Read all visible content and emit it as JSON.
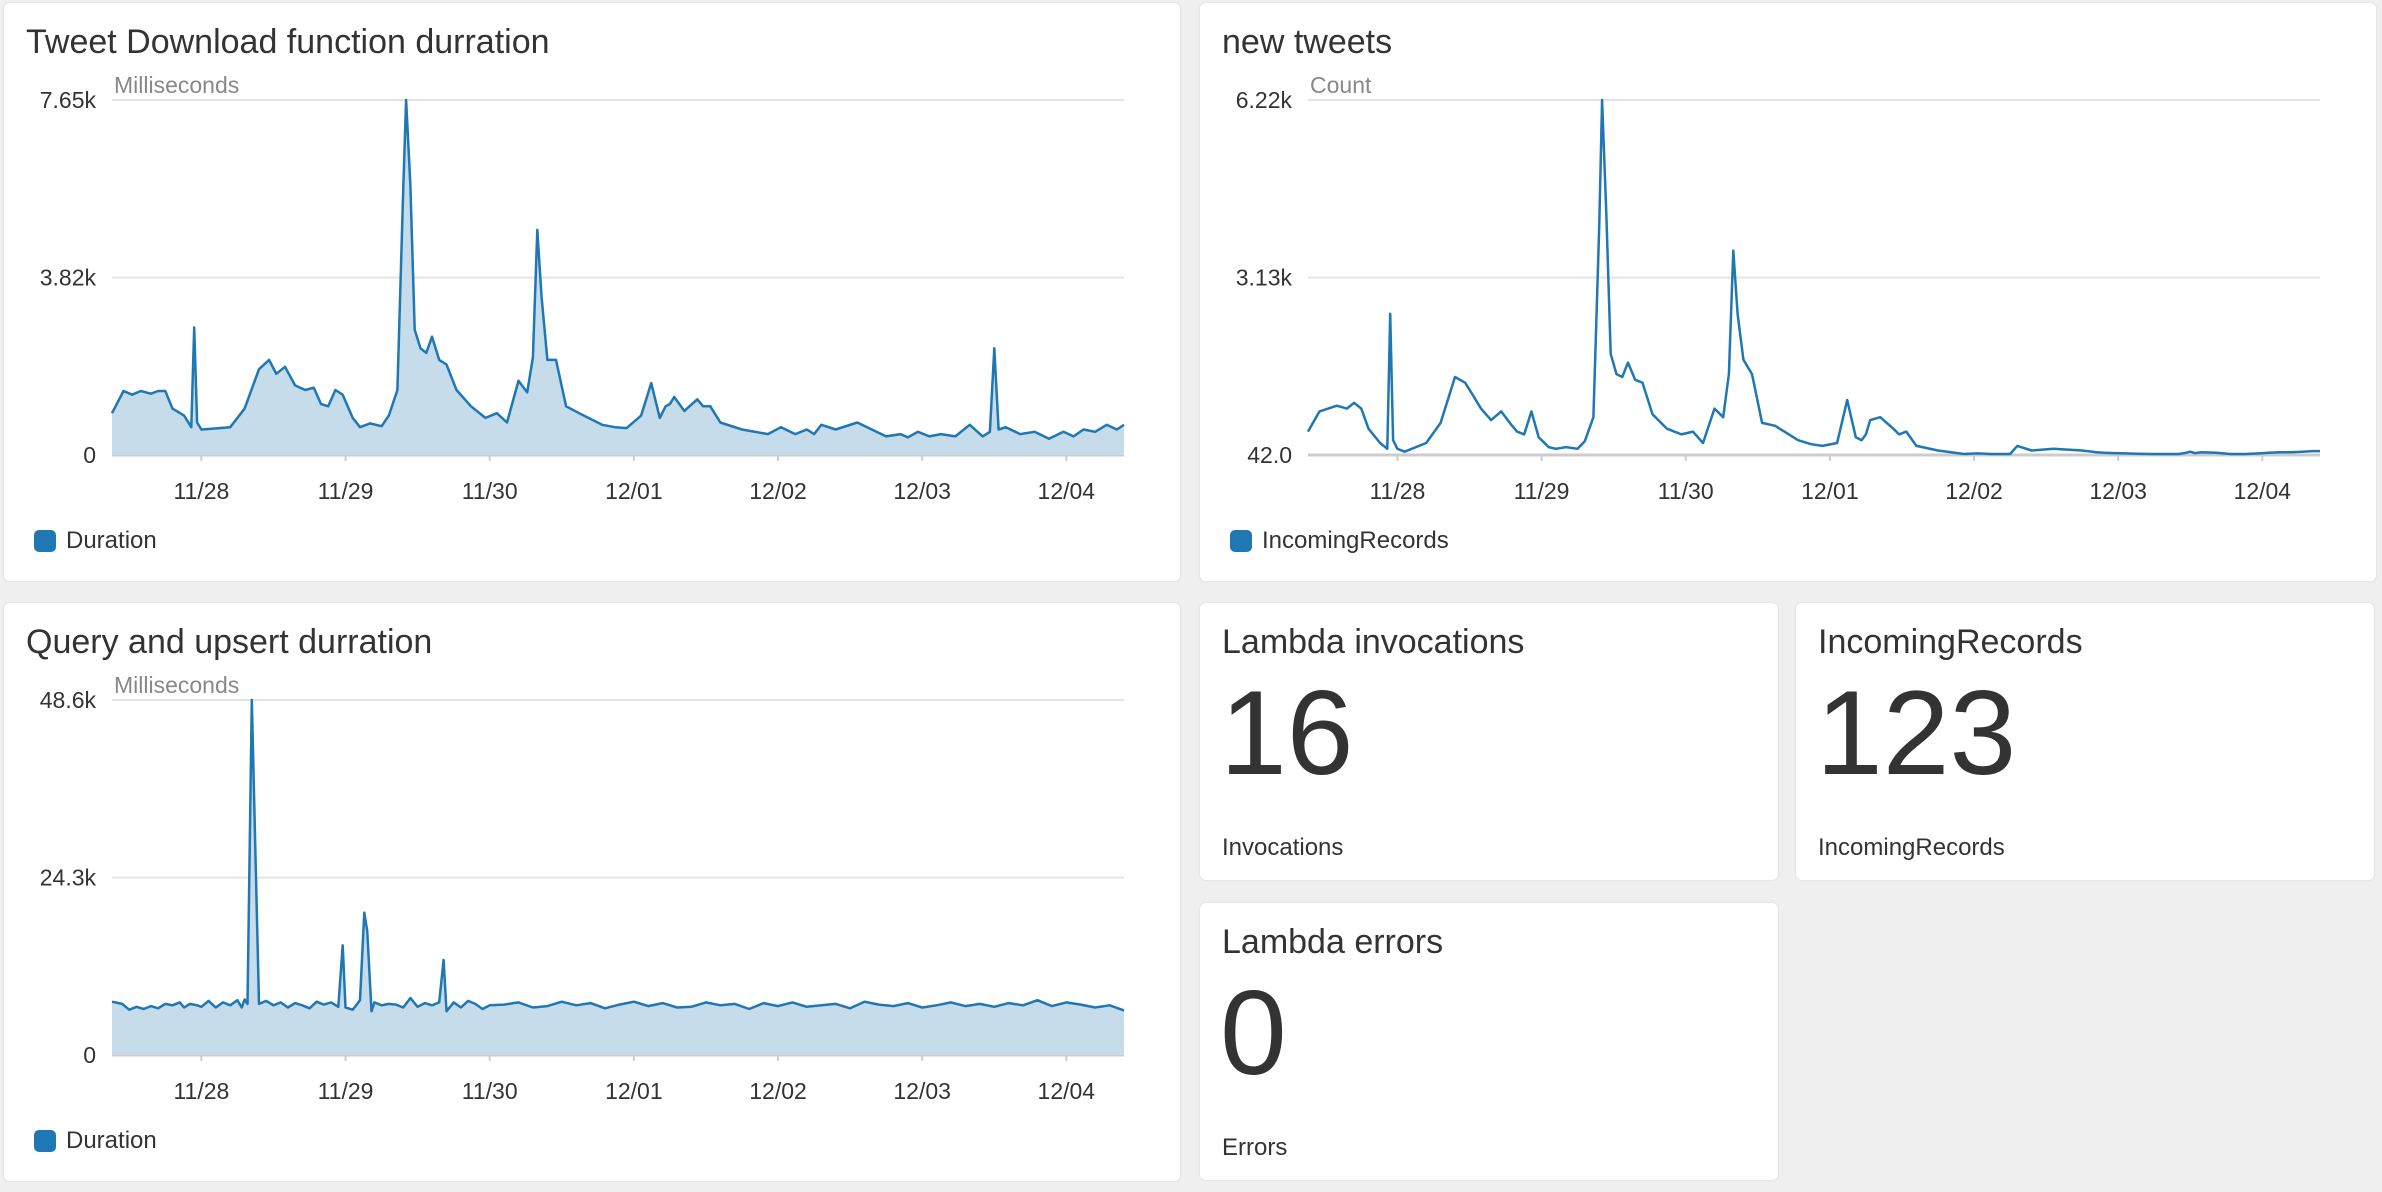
{
  "colors": {
    "series": "#1f77b4",
    "area": "#c6dcea",
    "grid": "#e4e4e4",
    "axis": "#cccccc"
  },
  "panels": {
    "tweet_download": {
      "title": "Tweet Download function durration",
      "unit": "Milliseconds",
      "legend": "Duration"
    },
    "new_tweets": {
      "title": "new tweets",
      "unit": "Count",
      "legend": "IncomingRecords"
    },
    "query_upsert": {
      "title": "Query and upsert durration",
      "unit": "Milliseconds",
      "legend": "Duration"
    },
    "lambda_invocations": {
      "title": "Lambda invocations",
      "value": "16",
      "label": "Invocations"
    },
    "incoming_records": {
      "title": "IncomingRecords",
      "value": "123",
      "label": "IncomingRecords"
    },
    "lambda_errors": {
      "title": "Lambda errors",
      "value": "0",
      "label": "Errors"
    }
  },
  "chart_data": [
    {
      "type": "area",
      "title": "Tweet Download function durration",
      "ylabel": "Milliseconds",
      "ylim": [
        0,
        7650
      ],
      "yticks": [
        "7.65k",
        "3.82k",
        "0"
      ],
      "xlim": [
        -0.62,
        6.4
      ],
      "xticks": [
        "11/28",
        "11/29",
        "11/30",
        "12/01",
        "12/02",
        "12/03",
        "12/04"
      ],
      "series": [
        {
          "name": "Duration",
          "x": [
            -0.62,
            -0.54,
            -0.48,
            -0.42,
            -0.35,
            -0.3,
            -0.25,
            -0.2,
            -0.12,
            -0.07,
            -0.05,
            -0.03,
            0.0,
            0.05,
            0.2,
            0.3,
            0.4,
            0.47,
            0.52,
            0.58,
            0.65,
            0.72,
            0.78,
            0.83,
            0.88,
            0.93,
            0.98,
            1.05,
            1.1,
            1.17,
            1.25,
            1.3,
            1.36,
            1.4,
            1.42,
            1.45,
            1.48,
            1.52,
            1.56,
            1.6,
            1.65,
            1.7,
            1.77,
            1.87,
            1.97,
            2.05,
            2.12,
            2.2,
            2.26,
            2.3,
            2.33,
            2.36,
            2.4,
            2.46,
            2.53,
            2.62,
            2.78,
            2.87,
            2.95,
            3.05,
            3.12,
            3.18,
            3.22,
            3.25,
            3.28,
            3.35,
            3.44,
            3.48,
            3.53,
            3.6,
            3.75,
            3.93,
            4.02,
            4.12,
            4.2,
            4.25,
            4.3,
            4.4,
            4.55,
            4.75,
            4.85,
            4.9,
            4.97,
            5.05,
            5.13,
            5.23,
            5.33,
            5.42,
            5.47,
            5.5,
            5.53,
            5.58,
            5.68,
            5.78,
            5.88,
            5.98,
            6.05,
            6.12,
            6.2,
            6.28,
            6.35,
            6.4
          ],
          "y": [
            900,
            1380,
            1300,
            1380,
            1320,
            1380,
            1380,
            1000,
            850,
            600,
            2750,
            700,
            550,
            560,
            600,
            1000,
            1850,
            2050,
            1750,
            1900,
            1500,
            1400,
            1450,
            1100,
            1050,
            1400,
            1300,
            800,
            600,
            680,
            620,
            850,
            1400,
            5700,
            7650,
            5800,
            2700,
            2300,
            2200,
            2550,
            2050,
            1950,
            1400,
            1050,
            800,
            900,
            700,
            1600,
            1350,
            2100,
            4850,
            3400,
            2050,
            2050,
            1050,
            900,
            650,
            600,
            580,
            850,
            1550,
            800,
            1050,
            1100,
            1250,
            950,
            1200,
            1050,
            1050,
            700,
            550,
            450,
            600,
            450,
            550,
            450,
            650,
            550,
            700,
            400,
            450,
            380,
            500,
            400,
            450,
            400,
            650,
            400,
            500,
            2300,
            550,
            600,
            450,
            500,
            350,
            500,
            400,
            550,
            500,
            650,
            550,
            650
          ]
        }
      ]
    },
    {
      "type": "line",
      "title": "new tweets",
      "ylabel": "Count",
      "ylim": [
        42,
        6220
      ],
      "yticks": [
        "6.22k",
        "3.13k",
        "42.0"
      ],
      "xlim": [
        -0.62,
        6.4
      ],
      "xticks": [
        "11/28",
        "11/29",
        "11/30",
        "12/01",
        "12/02",
        "12/03",
        "12/04"
      ],
      "series": [
        {
          "name": "IncomingRecords",
          "x": [
            -0.62,
            -0.54,
            -0.48,
            -0.42,
            -0.35,
            -0.3,
            -0.25,
            -0.2,
            -0.12,
            -0.07,
            -0.05,
            -0.03,
            0.0,
            0.05,
            0.2,
            0.3,
            0.4,
            0.47,
            0.52,
            0.58,
            0.65,
            0.72,
            0.78,
            0.83,
            0.88,
            0.93,
            0.98,
            1.05,
            1.1,
            1.17,
            1.25,
            1.3,
            1.36,
            1.4,
            1.42,
            1.45,
            1.48,
            1.52,
            1.56,
            1.6,
            1.65,
            1.7,
            1.77,
            1.87,
            1.97,
            2.05,
            2.12,
            2.2,
            2.26,
            2.3,
            2.33,
            2.36,
            2.4,
            2.46,
            2.53,
            2.62,
            2.78,
            2.87,
            2.95,
            3.05,
            3.12,
            3.18,
            3.22,
            3.25,
            3.28,
            3.35,
            3.44,
            3.48,
            3.53,
            3.6,
            3.75,
            3.93,
            4.02,
            4.12,
            4.2,
            4.25,
            4.3,
            4.4,
            4.55,
            4.75,
            4.85,
            4.9,
            4.97,
            5.05,
            5.13,
            5.23,
            5.33,
            5.42,
            5.47,
            5.5,
            5.53,
            5.58,
            5.68,
            5.78,
            5.88,
            5.98,
            6.05,
            6.12,
            6.2,
            6.28,
            6.35,
            6.4
          ],
          "y": [
            450,
            800,
            850,
            900,
            850,
            950,
            850,
            500,
            250,
            150,
            2500,
            300,
            150,
            100,
            250,
            600,
            1400,
            1300,
            1100,
            850,
            650,
            800,
            600,
            450,
            400,
            800,
            350,
            180,
            150,
            180,
            150,
            280,
            700,
            4000,
            6220,
            4200,
            1800,
            1450,
            1400,
            1650,
            1350,
            1300,
            750,
            500,
            400,
            450,
            250,
            850,
            700,
            1450,
            3600,
            2500,
            1700,
            1450,
            600,
            550,
            300,
            230,
            200,
            250,
            1000,
            350,
            300,
            400,
            650,
            700,
            500,
            400,
            450,
            200,
            120,
            60,
            70,
            60,
            60,
            60,
            200,
            120,
            150,
            120,
            90,
            80,
            75,
            70,
            65,
            60,
            60,
            60,
            80,
            100,
            75,
            90,
            80,
            60,
            60,
            70,
            80,
            90,
            90,
            100,
            110,
            110
          ]
        }
      ]
    },
    {
      "type": "area",
      "title": "Query and upsert durration",
      "ylabel": "Milliseconds",
      "ylim": [
        0,
        48600
      ],
      "yticks": [
        "48.6k",
        "24.3k",
        "0"
      ],
      "xlim": [
        -0.62,
        6.4
      ],
      "xticks": [
        "11/28",
        "11/29",
        "11/30",
        "12/01",
        "12/02",
        "12/03",
        "12/04"
      ],
      "series": [
        {
          "name": "Duration",
          "x": [
            -0.62,
            -0.55,
            -0.5,
            -0.45,
            -0.4,
            -0.35,
            -0.3,
            -0.25,
            -0.2,
            -0.15,
            -0.12,
            -0.08,
            -0.03,
            0.0,
            0.05,
            0.1,
            0.15,
            0.2,
            0.25,
            0.28,
            0.3,
            0.32,
            0.35,
            0.4,
            0.45,
            0.5,
            0.55,
            0.6,
            0.65,
            0.7,
            0.75,
            0.8,
            0.85,
            0.9,
            0.95,
            0.98,
            1.0,
            1.05,
            1.1,
            1.13,
            1.15,
            1.18,
            1.2,
            1.25,
            1.3,
            1.35,
            1.4,
            1.45,
            1.5,
            1.55,
            1.6,
            1.65,
            1.68,
            1.7,
            1.75,
            1.8,
            1.85,
            1.9,
            1.95,
            2.0,
            2.1,
            2.2,
            2.3,
            2.4,
            2.5,
            2.6,
            2.7,
            2.8,
            2.9,
            3.0,
            3.1,
            3.2,
            3.3,
            3.4,
            3.5,
            3.6,
            3.7,
            3.8,
            3.9,
            4.0,
            4.1,
            4.2,
            4.3,
            4.4,
            4.5,
            4.6,
            4.7,
            4.8,
            4.9,
            5.0,
            5.1,
            5.2,
            5.3,
            5.4,
            5.5,
            5.6,
            5.7,
            5.8,
            5.9,
            6.0,
            6.1,
            6.2,
            6.3,
            6.4
          ],
          "y": [
            7300,
            7000,
            6200,
            6600,
            6300,
            6700,
            6400,
            7000,
            6800,
            7200,
            6500,
            7000,
            6800,
            6600,
            7400,
            6500,
            7200,
            6800,
            7500,
            6500,
            7600,
            7000,
            48600,
            7000,
            7400,
            6800,
            7200,
            6500,
            7100,
            6800,
            6400,
            7300,
            6900,
            7200,
            6600,
            15000,
            6500,
            6200,
            7500,
            19500,
            17000,
            6000,
            7200,
            6800,
            7000,
            6900,
            6500,
            7800,
            6600,
            7100,
            6800,
            7200,
            13000,
            6000,
            7200,
            6500,
            7400,
            7000,
            6300,
            6800,
            6900,
            7200,
            6500,
            6700,
            7300,
            6800,
            7100,
            6400,
            6900,
            7300,
            6700,
            7100,
            6500,
            6600,
            7200,
            6800,
            7000,
            6300,
            7100,
            6700,
            7200,
            6600,
            6800,
            7000,
            6400,
            7300,
            6900,
            6700,
            7100,
            6500,
            6800,
            7200,
            6700,
            7000,
            6600,
            7100,
            6800,
            7500,
            6700,
            7200,
            6900,
            6500,
            6800,
            6100
          ]
        }
      ]
    }
  ]
}
